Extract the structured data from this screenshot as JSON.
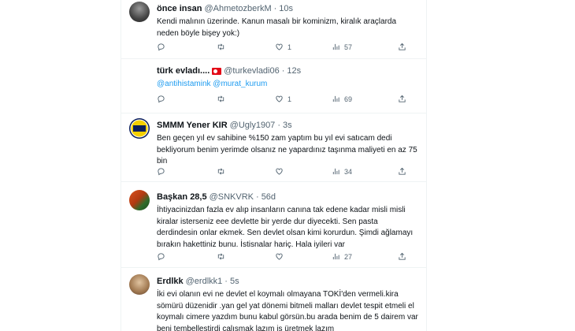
{
  "tweets": [
    {
      "name": "önce insan",
      "handle": "@AhmetozberkM",
      "time": "10s",
      "text": "Kendi malının üzerinde. Kanun masalı bir kominizm, kiralık araçlarda neden böyle bişey yok:)",
      "replies": "",
      "retweets": "",
      "likes": "1",
      "views": "57"
    },
    {
      "name": "türk evladı....",
      "handle": "@turkevladi06",
      "time": "12s",
      "mention1": "@antihistamink",
      "mention2": "@murat_kurum",
      "replies": "",
      "retweets": "",
      "likes": "1",
      "views": "69"
    },
    {
      "name": "SMMM Yener KIR",
      "handle": "@Ugly1907",
      "time": "3s",
      "text": "Ben geçen yıl ev sahibine %150 zam yaptım bu yıl evi satıcam dedi bekliyorum benim yerimde olsanız ne yapardınız taşınma maliyeti en az 75 bin",
      "replies": "",
      "retweets": "",
      "likes": "",
      "views": "34"
    },
    {
      "name": "Başkan 28,5",
      "handle": "@SNKVRK",
      "time": "56d",
      "text": "İhtiyacinizdan fazla ev alıp insanların canına tak edene kadar misli misli kiralar isterseniz eee devlette bir yerde dur diyecekti. Sen pasta derdindesin onlar ekmek. Sen devlet olsan kimi korurdun. Şimdi ağlamayı bırakın hakettiniz bunu. İstisnalar hariç. Hala iyileri var",
      "replies": "",
      "retweets": "",
      "likes": "",
      "views": "27"
    },
    {
      "name": "Erdlkk",
      "handle": "@erdlkk1",
      "time": "5s",
      "text": "İki evi olanın evi ne devlet el koymalı olmayana TOKİ'den vermeli.kira sömürü düzenidir .yan gel yat dönemi bitmeli malları devlet tespit etmeli el koymalı cimere yazdım bunu kabul görsün.bu arada benim de 5 dairem var beni tembelleştirdi çalışmak lazım iş üretmek lazım"
    }
  ],
  "icons": {
    "reply": "reply-icon",
    "retweet": "retweet-icon",
    "like": "heart-icon",
    "views": "views-icon",
    "share": "share-icon"
  },
  "colors": {
    "text": "#0f1419",
    "secondary": "#536471",
    "link": "#1d9bf0",
    "border": "#eff3f4"
  }
}
